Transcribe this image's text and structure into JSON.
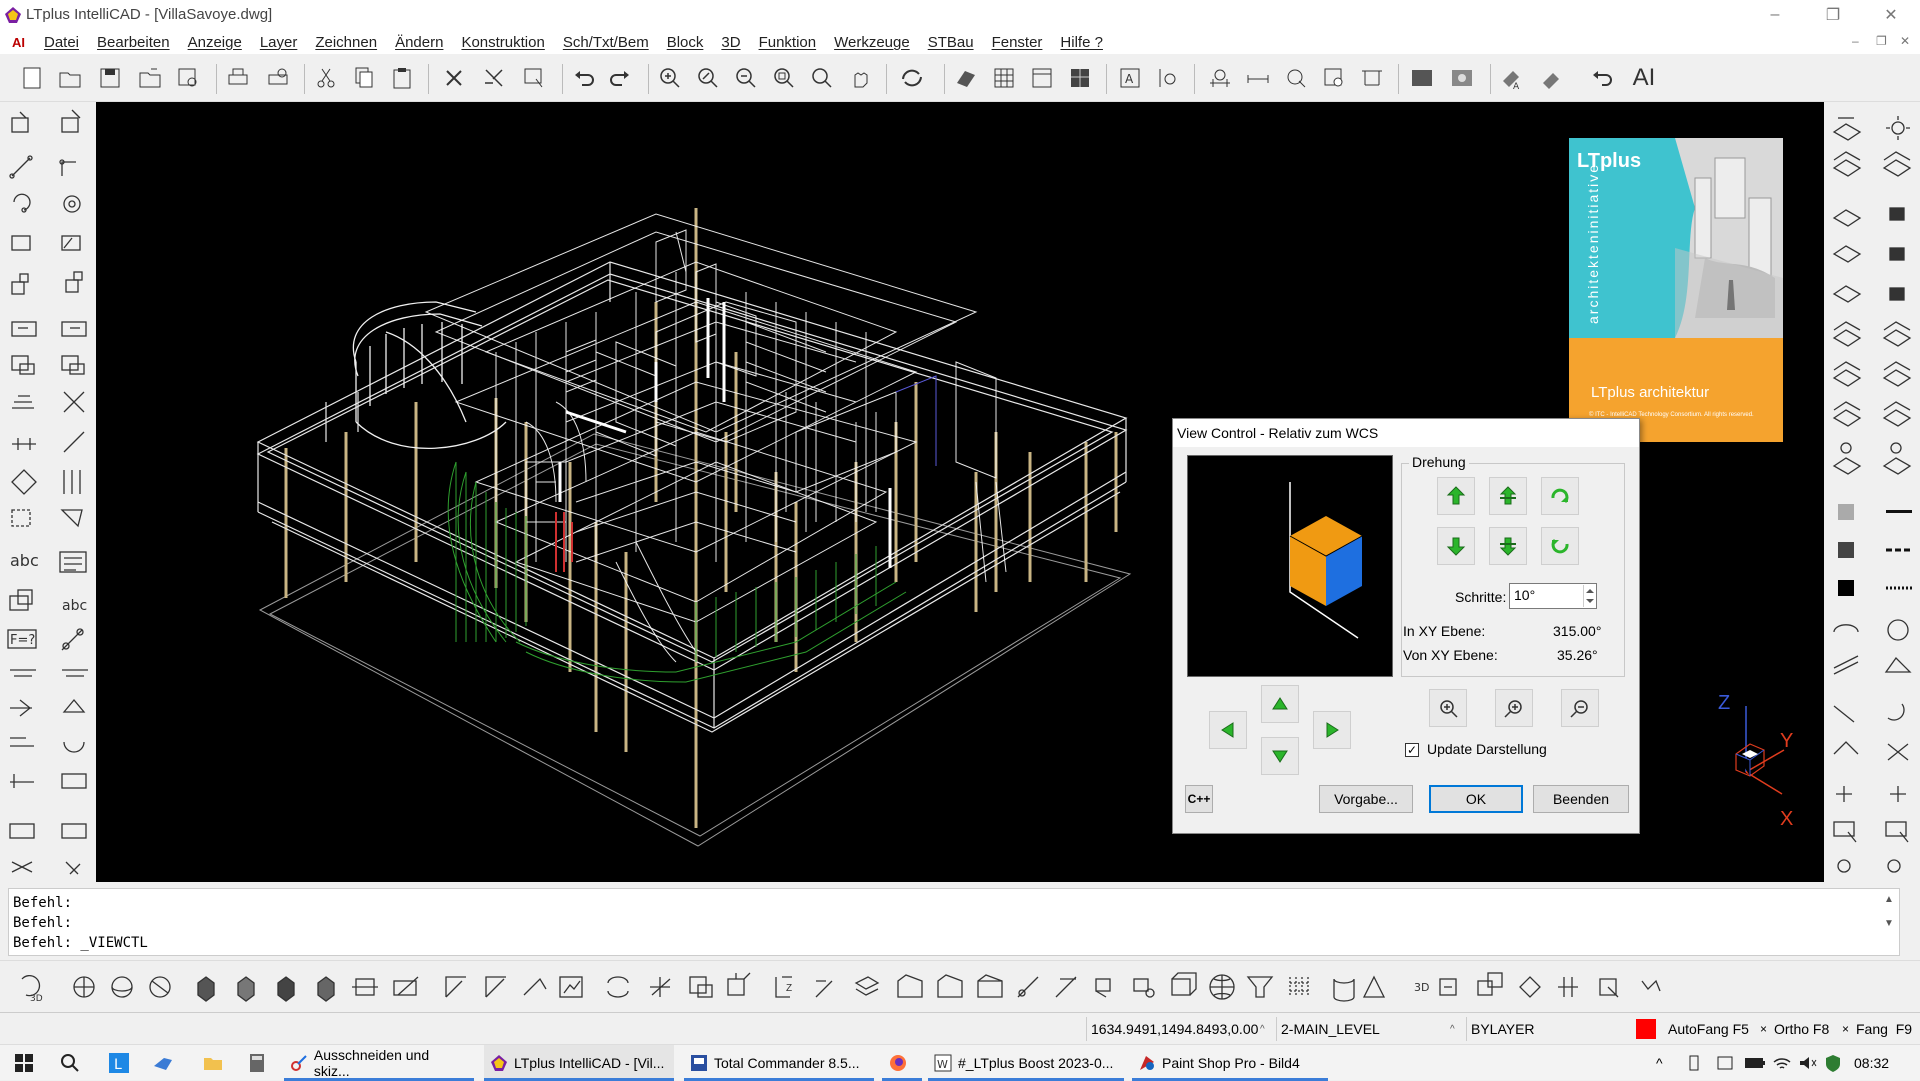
{
  "window": {
    "title": "LTplus IntelliCAD - [VillaSavoye.dwg]",
    "minimize_glyph": "–",
    "restore_glyph": "❐",
    "close_glyph": "✕"
  },
  "menu": {
    "ai_mark": "AI",
    "items": [
      "Datei",
      "Bearbeiten",
      "Anzeige",
      "Layer",
      "Zeichnen",
      "Ändern",
      "Konstruktion",
      "Sch/Txt/Bem",
      "Block",
      "3D",
      "Funktion",
      "Werkzeuge",
      "STBau",
      "Fenster",
      "Hilfe ?"
    ],
    "mdi_controls": [
      "–",
      "❐",
      "✕"
    ]
  },
  "toolbar_top": {
    "ai_label": "AI"
  },
  "splash": {
    "brand": "LTplus",
    "vertical_text": "architekteninitiative",
    "caption": "LTplus architektur",
    "fineprint": "© ITC - IntelliCAD Technology Consortium. All rights reserved.",
    "colors": {
      "cyan": "#3fc3cf",
      "orange": "#f5a32e"
    }
  },
  "dialog": {
    "title": "View Control - Relativ zum WCS",
    "group_label": "Drehung",
    "schritte_label": "Schritte:",
    "schritte_value": "10°",
    "in_xy_label": "In XY Ebene:",
    "in_xy_value": "315.00°",
    "von_xy_label": "Von XY Ebene:",
    "von_xy_value": "35.26°",
    "update_label": "Update Darstellung",
    "update_checked": true,
    "cpp_label": "C++",
    "vorgabe_label": "Vorgabe...",
    "ok_label": "OK",
    "beenden_label": "Beenden"
  },
  "ucs": {
    "z": "Z",
    "y": "Y",
    "x": "X"
  },
  "command": {
    "lines": [
      "Befehl:",
      "Befehl:",
      "Befehl: _VIEWCTL"
    ]
  },
  "statusbar": {
    "coords": "1634.9491,1494.8493,0.00",
    "layer": "2-MAIN_LEVEL",
    "linetype": "BYLAYER",
    "color_swatch": "#ff0000",
    "autofang": "AutoFang F5",
    "ortho": "Ortho F8",
    "fang": "Fang  F9"
  },
  "taskbar": {
    "tasks": [
      "Ausschneiden und skiz...",
      "LTplus IntelliCAD - [Vil...",
      "Total Commander 8.5...",
      "",
      "#_LTplus Boost 2023-0...",
      "Paint Shop Pro - Bild4"
    ],
    "clock": "08:32"
  }
}
